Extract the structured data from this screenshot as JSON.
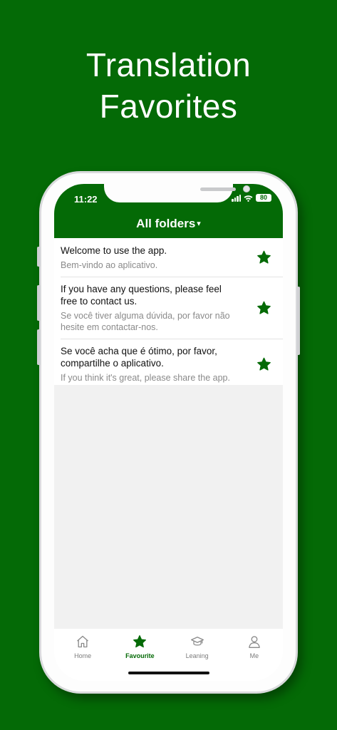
{
  "headline": {
    "line1": "Translation",
    "line2": "Favorites"
  },
  "status": {
    "time": "11:22",
    "battery": "80"
  },
  "header": {
    "title": "All folders",
    "caret": "▾"
  },
  "favorites": [
    {
      "source": "Welcome to use the app.",
      "translation": "Bem-vindo ao aplicativo.",
      "icon": "star-icon"
    },
    {
      "source": "If you have any questions, please feel free to contact us.",
      "translation": "Se você tiver alguma dúvida, por favor não hesite em contactar-nos.",
      "icon": "star-icon"
    },
    {
      "source": "Se você acha que é ótimo, por favor, compartilhe o aplicativo.",
      "translation": "If you think it's great, please share the app.",
      "icon": "star-icon"
    }
  ],
  "tabs": [
    {
      "label": "Home",
      "icon": "home-icon",
      "active": false
    },
    {
      "label": "Favourite",
      "icon": "star-icon",
      "active": true
    },
    {
      "label": "Leaning",
      "icon": "graduation-cap-icon",
      "active": false
    },
    {
      "label": "Me",
      "icon": "person-icon",
      "active": false
    }
  ],
  "colors": {
    "brand": "#046a06",
    "empty_bg": "#f1f1f1",
    "inactive_tab": "#7c7c7c"
  }
}
